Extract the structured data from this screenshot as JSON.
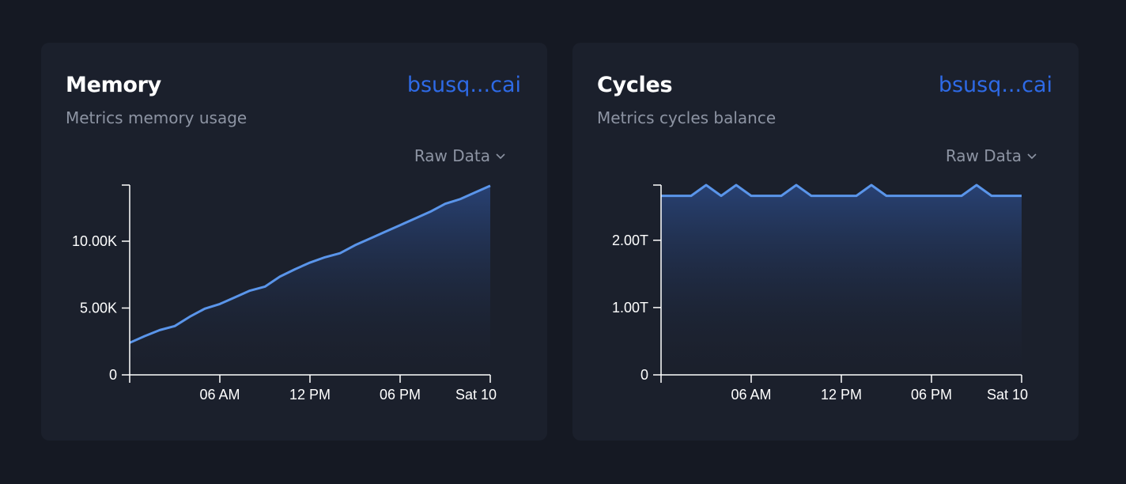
{
  "cards": [
    {
      "title": "Memory",
      "link": "bsusq...cai",
      "subtitle": "Metrics memory usage",
      "dropdown": "Raw Data",
      "chart_data": {
        "type": "area",
        "x_tick_labels": [
          "06 AM",
          "12 PM",
          "06 PM",
          "Sat 10"
        ],
        "y_tick_labels": [
          "0",
          "5.00K",
          "10.00K"
        ],
        "y_ticks": [
          0,
          5000,
          10000
        ],
        "ylim": [
          0,
          14200
        ],
        "x": [
          0,
          1,
          2,
          3,
          4,
          5,
          6,
          7,
          8,
          9,
          10,
          11,
          12,
          13,
          14,
          15,
          16,
          17,
          18,
          19,
          20,
          21,
          22,
          23,
          24
        ],
        "values": [
          2400,
          2900,
          3350,
          3650,
          4350,
          4950,
          5300,
          5800,
          6300,
          6600,
          7350,
          7900,
          8400,
          8800,
          9100,
          9700,
          10200,
          10700,
          11200,
          11700,
          12200,
          12800,
          13150,
          13650,
          14150
        ]
      }
    },
    {
      "title": "Cycles",
      "link": "bsusq...cai",
      "subtitle": "Metrics cycles balance",
      "dropdown": "Raw Data",
      "chart_data": {
        "type": "area",
        "x_tick_labels": [
          "06 AM",
          "12 PM",
          "06 PM",
          "Sat 10"
        ],
        "y_tick_labels": [
          "0",
          "1.00T",
          "2.00T"
        ],
        "y_ticks": [
          0,
          1,
          2
        ],
        "ylim": [
          0,
          2.82
        ],
        "x": [
          0,
          1,
          2,
          3,
          4,
          5,
          6,
          7,
          8,
          9,
          10,
          11,
          12,
          13,
          14,
          15,
          16,
          17,
          18,
          19,
          20,
          21,
          22,
          23,
          24
        ],
        "values": [
          2.66,
          2.66,
          2.66,
          2.82,
          2.66,
          2.82,
          2.66,
          2.66,
          2.66,
          2.82,
          2.66,
          2.66,
          2.66,
          2.66,
          2.82,
          2.66,
          2.66,
          2.66,
          2.66,
          2.66,
          2.66,
          2.82,
          2.66,
          2.66,
          2.66
        ]
      }
    }
  ],
  "colors": {
    "background": "#151923",
    "card": "#1b202c",
    "line": "#5a95ea",
    "link": "#2e6ae6",
    "muted": "#8d94a3"
  }
}
